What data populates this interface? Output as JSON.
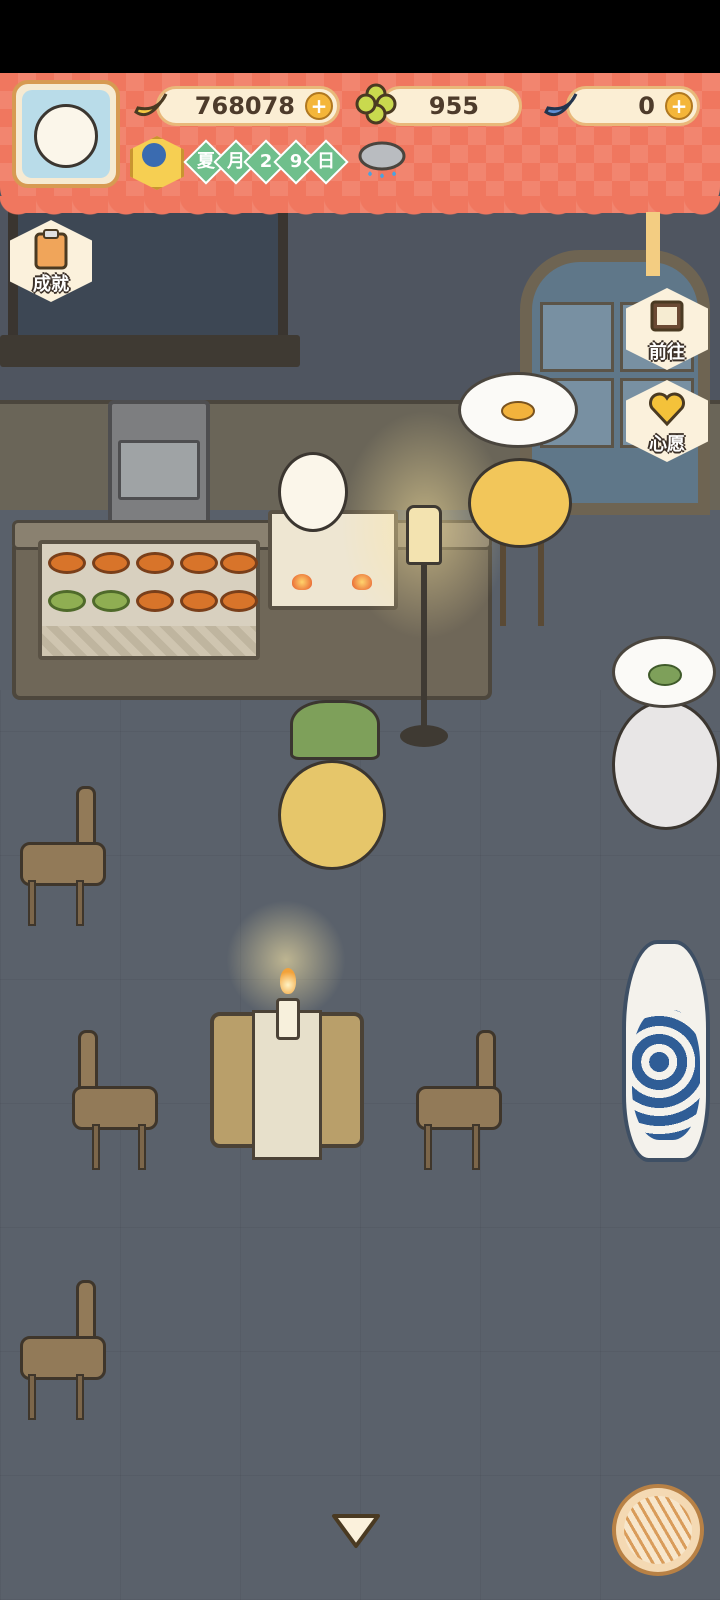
{
  "hud": {
    "currencies": [
      {
        "name": "banana",
        "value": "768078",
        "icon": "banana-icon"
      },
      {
        "name": "clover",
        "value": "955",
        "icon": "clover-icon"
      },
      {
        "name": "blue-banana",
        "value": "0",
        "icon": "blue-banana-icon"
      }
    ],
    "plus_label": "+",
    "date": {
      "season": "夏",
      "month_char": "月",
      "day_tens": "2",
      "day_ones": "9",
      "day_char": "日"
    },
    "weather": "rain-cloud-icon"
  },
  "side_buttons": {
    "achievements": "成就",
    "goto": "前往",
    "wish": "心愿"
  },
  "colors": {
    "hud_bg": "#f0775f",
    "pill_bg": "#fbeed4",
    "date_green": "#6fbf8c",
    "accent_gold": "#f4b63a"
  }
}
